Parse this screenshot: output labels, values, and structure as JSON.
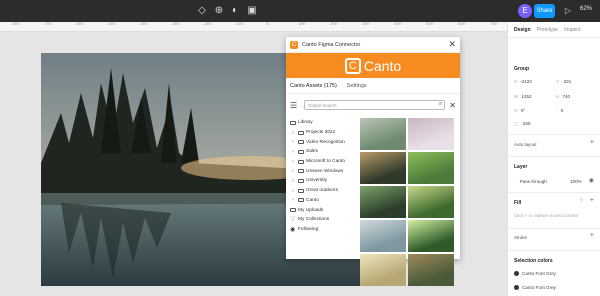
{
  "topbar": {
    "avatar_initial": "E",
    "share_label": "Share",
    "play_icon": "play-icon",
    "zoom": "62%"
  },
  "ruler": {
    "ticks": [
      "-800",
      "-700",
      "-600",
      "-500",
      "-400",
      "-300",
      "-200",
      "-100",
      "0",
      "100",
      "200",
      "300",
      "400",
      "500",
      "600",
      "700"
    ]
  },
  "plugin": {
    "title": "Canto Figma Connector",
    "brand": "Canto",
    "tabs": [
      "Canto Assets (175)",
      "Settings"
    ],
    "search_placeholder": "Global Search",
    "tree": [
      {
        "label": "Library",
        "type": "folder",
        "chevron": false
      },
      {
        "label": "Projects 2021",
        "type": "folder",
        "chevron": true
      },
      {
        "label": "Video Recognition",
        "type": "folder",
        "chevron": true
      },
      {
        "label": "Sales",
        "type": "folder",
        "chevron": true
      },
      {
        "label": "Microsoft to Canto",
        "type": "folder",
        "chevron": true
      },
      {
        "label": "Unseen Windows",
        "type": "folder",
        "chevron": true
      },
      {
        "label": "University",
        "type": "folder",
        "chevron": true
      },
      {
        "label": "Great outdoors",
        "type": "folder",
        "chevron": true
      },
      {
        "label": "Canto",
        "type": "folder",
        "chevron": true
      },
      {
        "label": "My Uploads",
        "type": "upload",
        "chevron": false
      },
      {
        "label": "My Collections",
        "type": "heart",
        "chevron": false
      },
      {
        "label": "Following",
        "type": "eye",
        "chevron": false
      }
    ],
    "thumbs": [
      {
        "a": "#6f8a6e",
        "b": "#b9c6b5"
      },
      {
        "a": "#e9dfe6",
        "b": "#c9b6c2"
      },
      {
        "a": "#2f3a2a",
        "b": "#b99a6a"
      },
      {
        "a": "#4e7b3a",
        "b": "#8cbf5a"
      },
      {
        "a": "#2d3f2c",
        "b": "#7da36a"
      },
      {
        "a": "#3f6a2e",
        "b": "#c7d98a"
      },
      {
        "a": "#7f97a0",
        "b": "#cfd9dc"
      },
      {
        "a": "#2f5a2a",
        "b": "#d4f0a0"
      },
      {
        "a": "#b7a774",
        "b": "#efe6c0"
      },
      {
        "a": "#4a5a3a",
        "b": "#a08a5a"
      }
    ]
  },
  "right_panel": {
    "tabs": [
      "Design",
      "Prototype",
      "Inspect"
    ],
    "group_label": "Group",
    "x": "-2423",
    "y": "-331",
    "w": "1252",
    "h": "740",
    "rotation": "0°",
    "radius": "0",
    "clip": "-269",
    "auto_layout": "Auto layout",
    "layer_label": "Layer",
    "blend": "Pass through",
    "opacity": "100%",
    "fill_label": "Fill",
    "fill_hint": "Click + to replace mixed content",
    "stroke_label": "Stroke",
    "selection_colors_label": "Selection colors",
    "colors": [
      "Canto Font Grey",
      "Canto Font Grey"
    ]
  }
}
